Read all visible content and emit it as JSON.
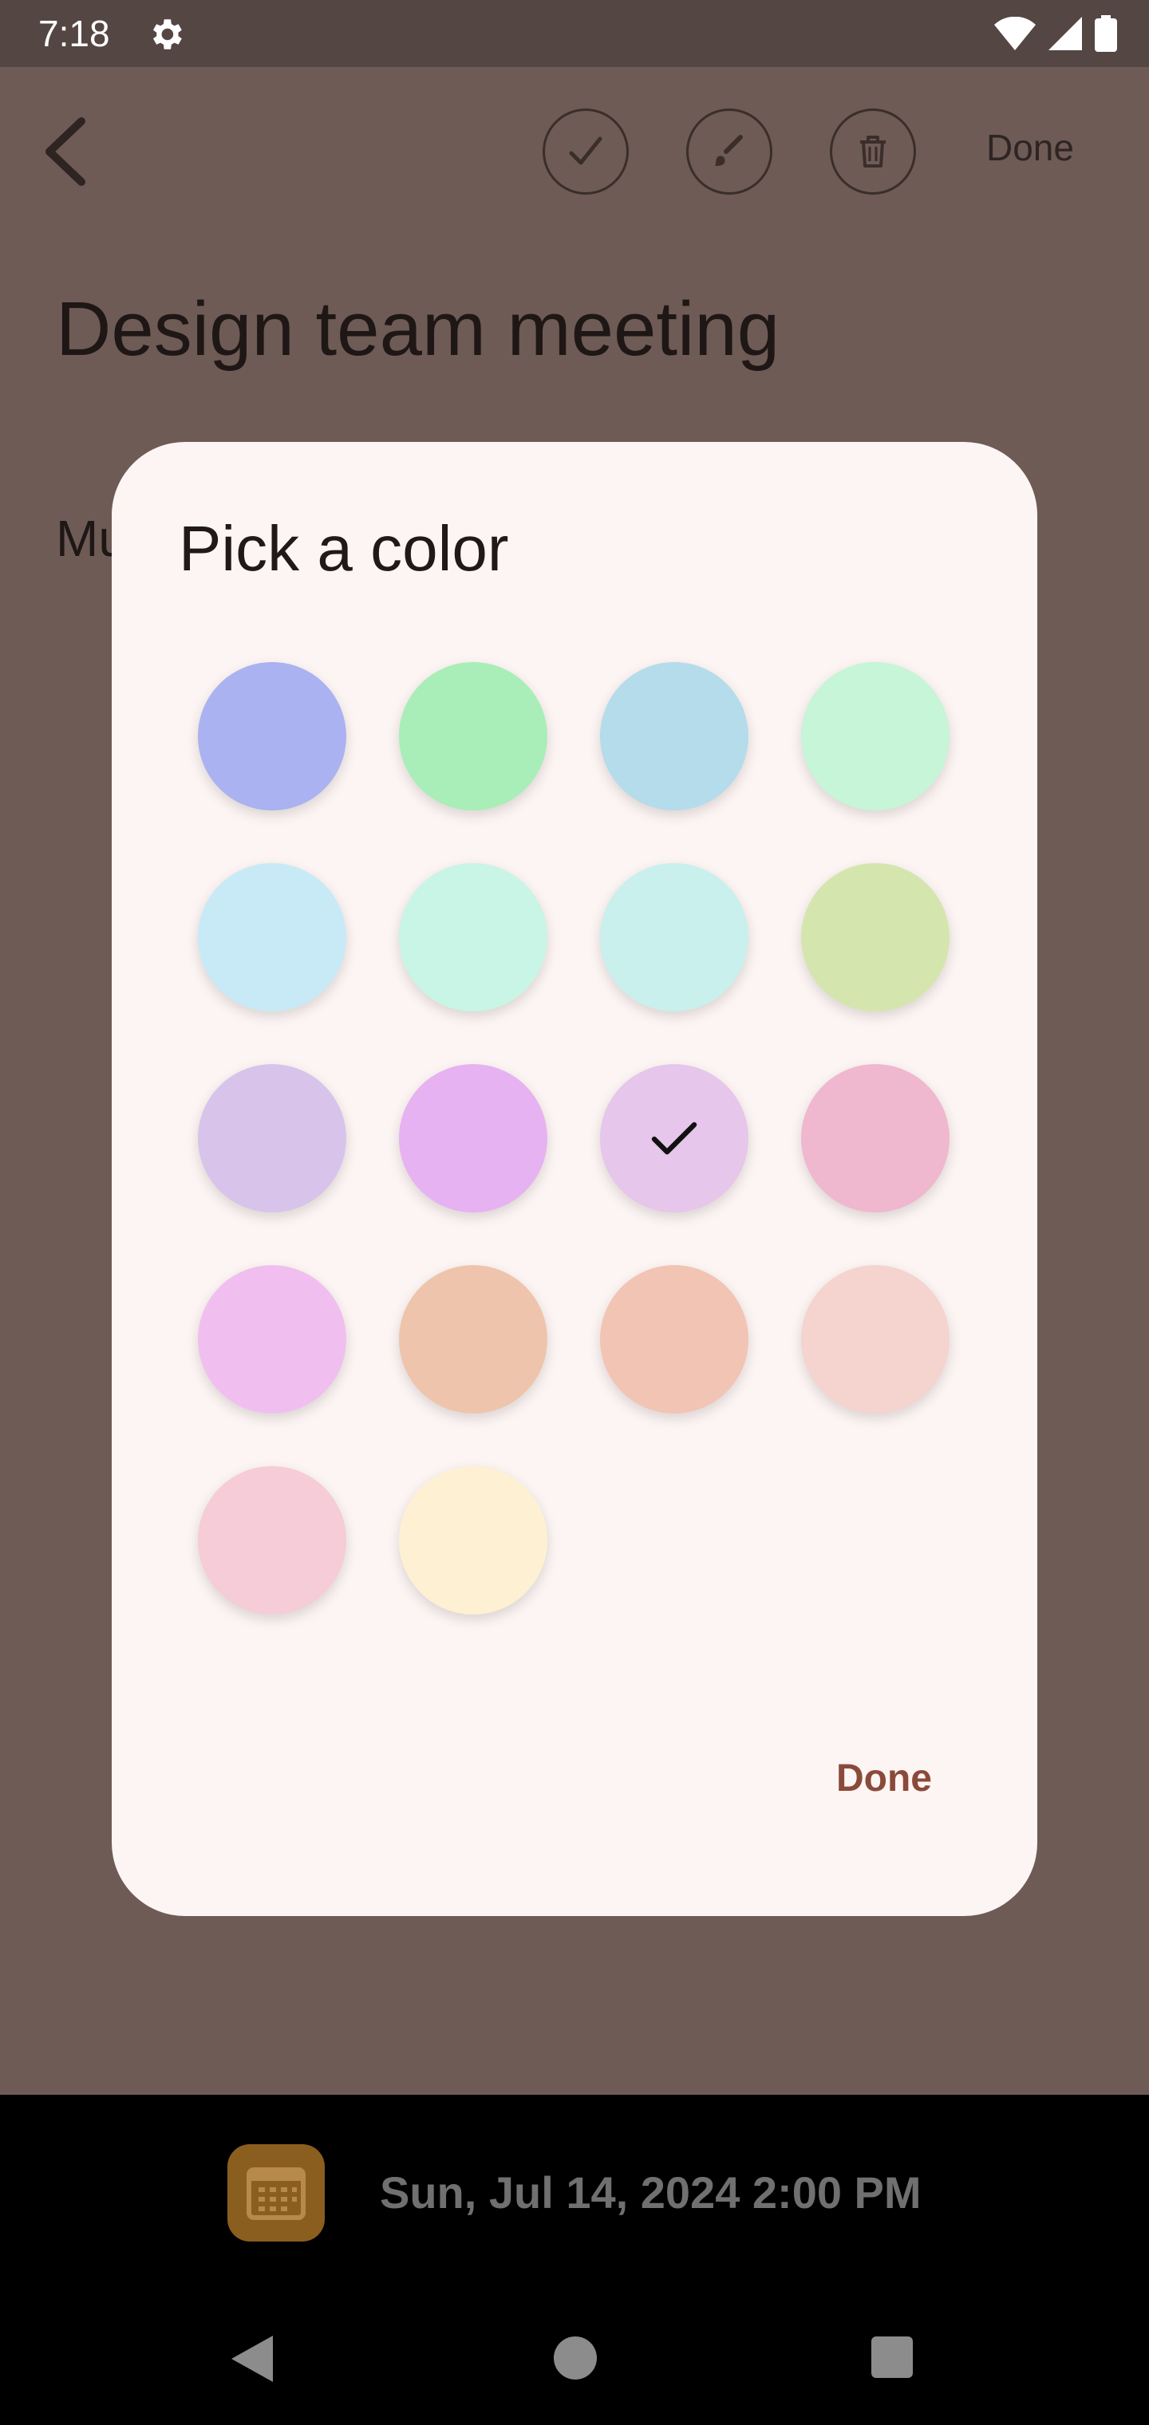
{
  "status_bar": {
    "time": "7:18",
    "icons": [
      "settings-gear-icon",
      "wifi-icon",
      "signal-icon",
      "battery-icon"
    ]
  },
  "toolbar": {
    "back_icon": "chevron-left-icon",
    "actions": [
      "check-icon",
      "brush-icon",
      "trash-icon"
    ],
    "done_label": "Done"
  },
  "note": {
    "title": "Design team meeting",
    "body_visible": "Mu"
  },
  "color_dialog": {
    "title": "Pick a color",
    "selected_index": 10,
    "swatches": [
      "#aab2f1",
      "#a9eeb8",
      "#b5dceb",
      "#c6f5d8",
      "#c8eaf7",
      "#c9f5e6",
      "#c9f0ec",
      "#d4e6ae",
      "#d8c4eb",
      "#e7b2f1",
      "#e6c6ea",
      "#efb8cf",
      "#f0bff0",
      "#efc4ac",
      "#f2c4b4",
      "#f5d3cf",
      "#f5ccd7",
      "#fef1d3"
    ],
    "done_label": "Done"
  },
  "bottom": {
    "calendar_icon": "calendar-icon",
    "datetime": "Sun, Jul 14, 2024 2:00 PM"
  },
  "nav": [
    "back-triangle-icon",
    "home-circle-icon",
    "recents-square-icon"
  ]
}
